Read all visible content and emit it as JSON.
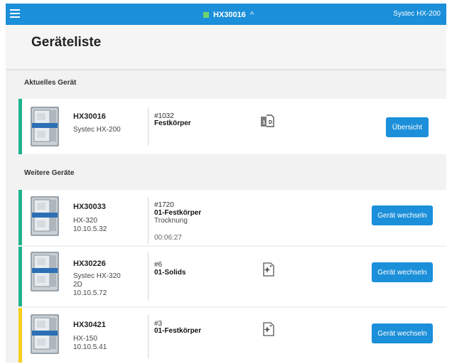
{
  "topbar": {
    "current_device": "HX30016",
    "brand": "Systec HX-200",
    "status_color": "#6fd36f",
    "accent": "#1b8fd9"
  },
  "page": {
    "title": "Geräteliste"
  },
  "sections": {
    "current_label": "Aktuelles Gerät",
    "others_label": "Weitere Geräte"
  },
  "current_device": {
    "name": "HX30016",
    "model": "Systec HX-200",
    "method_number": "#1032",
    "method_name": "Festkörper",
    "method_icon": "1d-document-icon",
    "status_color": "#1db38b",
    "button_label": "Übersicht"
  },
  "other_devices": [
    {
      "name": "HX30033",
      "model": "HX-320",
      "ip": "10.10.5.32",
      "method_number": "#1720",
      "method_name": "01-Festkörper",
      "phase": "Trocknung",
      "elapsed": "00:06:27",
      "status_color": "#1db38b",
      "button_label": "Gerät wechseln"
    },
    {
      "name": "HX30226",
      "model": "Systec HX-320",
      "variant": "2D",
      "ip": "10.10.5.72",
      "method_number": "#6",
      "method_name": "01-Solids",
      "method_icon": "sparkle-document-icon",
      "status_color": "#1db38b",
      "button_label": "Gerät wechseln"
    },
    {
      "name": "HX30421",
      "model": "HX-150",
      "ip": "10.10.5.41",
      "method_number": "#3",
      "method_name": "01-Festkörper",
      "method_icon": "sparkle-document-icon",
      "status_color": "#f5cf1d",
      "button_label": "Gerät wechseln"
    }
  ]
}
